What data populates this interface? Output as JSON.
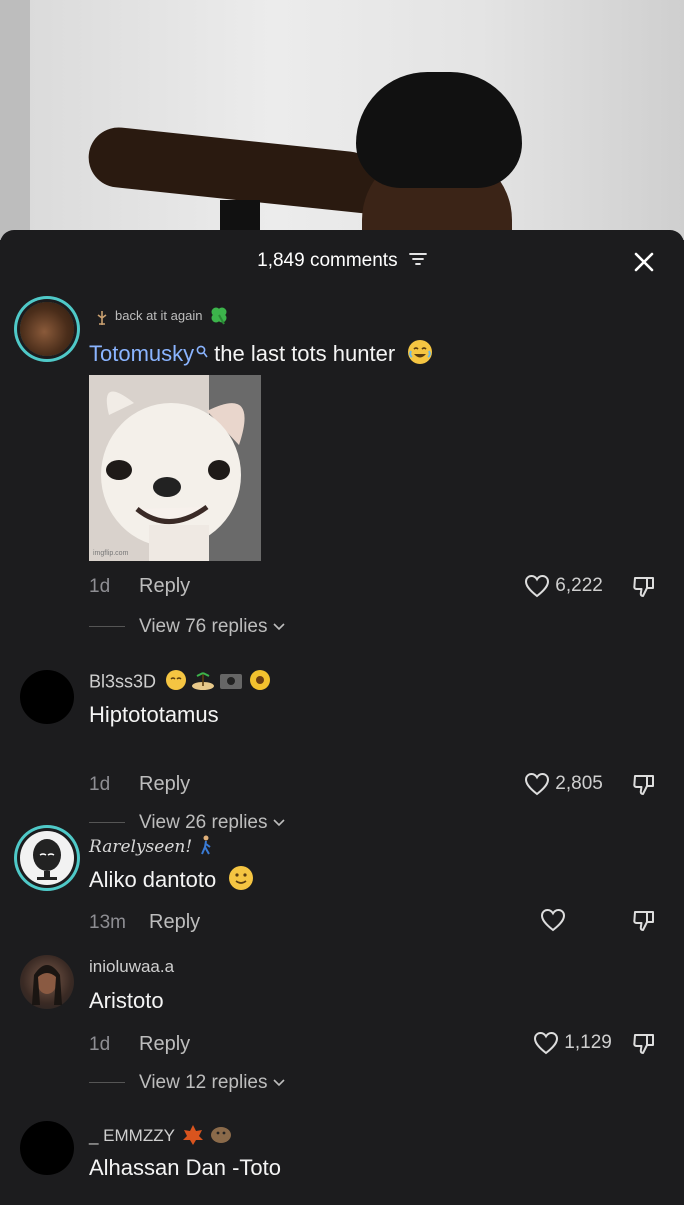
{
  "header": {
    "comment_count": "1,849 comments"
  },
  "comments": [
    {
      "tag": "back at it again",
      "username": "Totomusky",
      "text": "the last tots hunter",
      "time": "1d",
      "reply_label": "Reply",
      "likes": "6,222",
      "view_replies": "View 76 replies",
      "gif_watermark": "imgflip.com"
    },
    {
      "username": "Bl3ss3D",
      "text": "Hiptototamus",
      "time": "1d",
      "reply_label": "Reply",
      "likes": "2,805",
      "view_replies": "View 26 replies"
    },
    {
      "username": "Rarelyseen!",
      "text": "Aliko dantoto",
      "time": "13m",
      "reply_label": "Reply",
      "likes": ""
    },
    {
      "username": "inioluwaa.a",
      "text": "Aristoto",
      "time": "1d",
      "reply_label": "Reply",
      "likes": "1,129",
      "view_replies": "View 12 replies"
    },
    {
      "username": "_ EMMZZY",
      "text": "Alhassan Dan -Toto"
    }
  ],
  "colors": {
    "sheet_bg": "#1c1c1e",
    "mention": "#8ab4ff",
    "avatar_ring": "#4fc9c8",
    "muted": "#8e8e93"
  },
  "icons": [
    "filter-icon",
    "close-icon",
    "search-icon",
    "heart-icon",
    "dislike-icon",
    "chevron-down-icon",
    "clover-icon"
  ]
}
